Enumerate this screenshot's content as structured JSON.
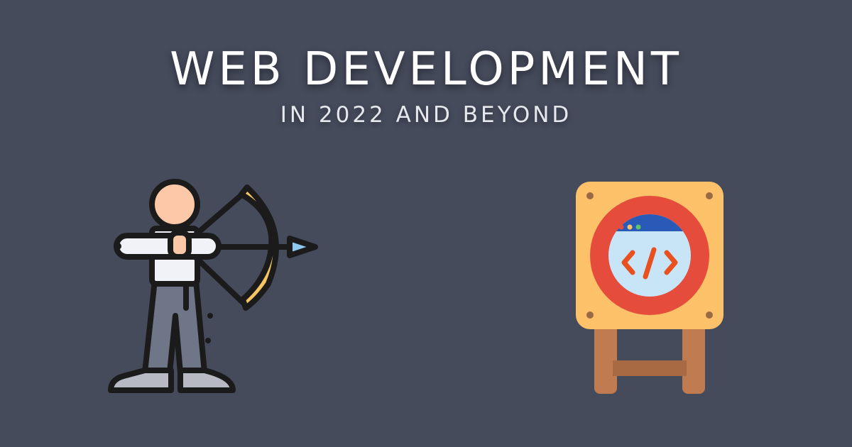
{
  "header": {
    "title": "WEB DEVELOPMENT",
    "subtitle": "IN 2022 AND BEYOND"
  },
  "illustrations": {
    "left_icon": "archer-icon",
    "right_icon": "code-target-icon"
  },
  "colors": {
    "background": "#464b5c",
    "text": "#ffffff",
    "target_board": "#fcc169",
    "target_ring": "#e64c3c",
    "target_center": "#c8e4f7",
    "code_symbol": "#e8501f",
    "stand": "#c07b50",
    "bow": "#f5c563"
  }
}
